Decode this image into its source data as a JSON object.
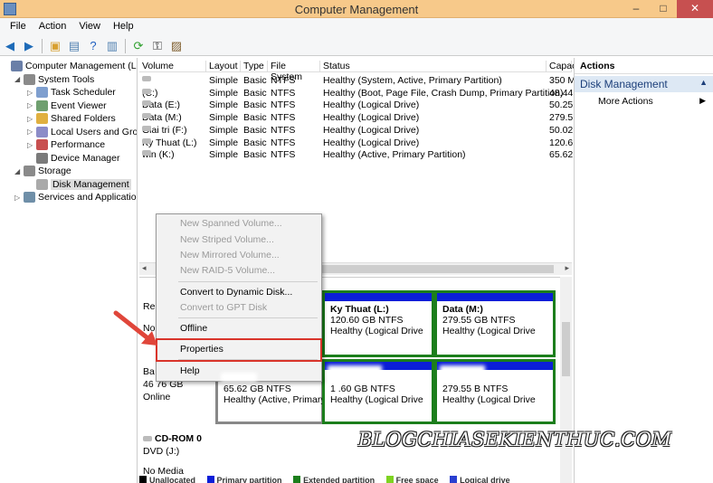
{
  "window": {
    "title": "Computer Management"
  },
  "menu": [
    "File",
    "Action",
    "View",
    "Help"
  ],
  "tree": [
    {
      "label": "Computer Management (Local",
      "indent": 0,
      "arrow": "",
      "icon": "#6a7fa8"
    },
    {
      "label": "System Tools",
      "indent": 1,
      "arrow": "◢",
      "icon": "#8a8a8a"
    },
    {
      "label": "Task Scheduler",
      "indent": 2,
      "arrow": "▷",
      "icon": "#7f9fcf"
    },
    {
      "label": "Event Viewer",
      "indent": 2,
      "arrow": "▷",
      "icon": "#6f9f6f"
    },
    {
      "label": "Shared Folders",
      "indent": 2,
      "arrow": "▷",
      "icon": "#e0b040"
    },
    {
      "label": "Local Users and Groups",
      "indent": 2,
      "arrow": "▷",
      "icon": "#8c8cc8"
    },
    {
      "label": "Performance",
      "indent": 2,
      "arrow": "▷",
      "icon": "#c85050"
    },
    {
      "label": "Device Manager",
      "indent": 2,
      "arrow": "",
      "icon": "#7a7a7a"
    },
    {
      "label": "Storage",
      "indent": 1,
      "arrow": "◢",
      "icon": "#8a8a8a"
    },
    {
      "label": "Disk Management",
      "indent": 2,
      "arrow": "",
      "icon": "#aaaaaa"
    },
    {
      "label": "Services and Applications",
      "indent": 1,
      "arrow": "▷",
      "icon": "#6f8fa8"
    }
  ],
  "volumes": {
    "headers": [
      "Volume",
      "Layout",
      "Type",
      "File System",
      "Status",
      "Capac"
    ],
    "rows": [
      [
        "",
        "Simple",
        "Basic",
        "NTFS",
        "Healthy (System, Active, Primary Partition)",
        "350 M"
      ],
      [
        "(C:)",
        "Simple",
        "Basic",
        "NTFS",
        "Healthy (Boot, Page File, Crash Dump, Primary Partition)",
        "48.44"
      ],
      [
        "Data (E:)",
        "Simple",
        "Basic",
        "NTFS",
        "Healthy (Logical Drive)",
        "50.25"
      ],
      [
        "Data (M:)",
        "Simple",
        "Basic",
        "NTFS",
        "Healthy (Logical Drive)",
        "279.5"
      ],
      [
        "Giai tri (F:)",
        "Simple",
        "Basic",
        "NTFS",
        "Healthy (Logical Drive)",
        "50.02"
      ],
      [
        "Ky Thuat (L:)",
        "Simple",
        "Basic",
        "NTFS",
        "Healthy (Logical Drive)",
        "120.6"
      ],
      [
        "win (K:)",
        "Simple",
        "Basic",
        "NTFS",
        "Healthy (Active, Primary Partition)",
        "65.62"
      ]
    ]
  },
  "disks": {
    "disk0_label": "Re",
    "disk0_label2": "No",
    "disk1_label": "Ba",
    "disk1_size": "46  76 GB",
    "disk1_status": "Online",
    "cdrom_label": "CD-ROM 0",
    "cdrom_dvd": "DVD (J:)",
    "cdrom_media": "No Media",
    "parts": [
      {
        "name": "Ky Thuat  (L:)",
        "size": "120.60 GB NTFS",
        "status": "Healthy (Logical Drive"
      },
      {
        "name": "Data  (M:)",
        "size": "279.55 GB NTFS",
        "status": "Healthy (Logical Drive"
      },
      {
        "name": "",
        "size": "65.62 GB NTFS",
        "status": "Healthy (Active, Primary"
      },
      {
        "name": "",
        "size": "1  .60 GB NTFS",
        "status": "Healthy (Logical Drive"
      },
      {
        "name": "",
        "size": "279.55  B NTFS",
        "status": "Healthy (Logical Drive"
      }
    ]
  },
  "legend": [
    "Unallocated",
    "Primary partition",
    "Extended partition",
    "Free space",
    "Logical drive"
  ],
  "actions": {
    "header": "Actions",
    "section": "Disk Management",
    "more": "More Actions"
  },
  "context_menu": [
    {
      "label": "New Spanned Volume...",
      "disabled": true
    },
    {
      "label": "New Striped Volume...",
      "disabled": true
    },
    {
      "label": "New Mirrored Volume...",
      "disabled": true
    },
    {
      "label": "New RAID-5 Volume...",
      "disabled": true
    },
    {
      "label": "Convert to Dynamic Disk...",
      "disabled": false
    },
    {
      "label": "Convert to GPT Disk",
      "disabled": true
    },
    {
      "label": "Offline",
      "disabled": false
    },
    {
      "label": "Properties",
      "disabled": false
    },
    {
      "label": "Help",
      "disabled": false
    }
  ],
  "watermark": "BLOGCHIASEKIENTHUC.COM",
  "colors": {
    "titlebar": "#f7c98a",
    "partition_bar": "#0b1ed8",
    "partition_border": "#1c7e1c",
    "highlight": "#d9342b",
    "arrow": "#e0463a"
  }
}
